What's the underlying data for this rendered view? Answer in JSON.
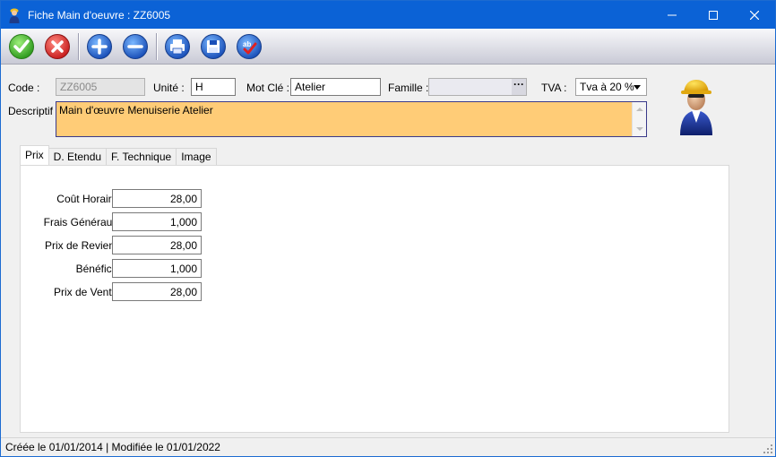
{
  "window": {
    "title": "Fiche Main d'oeuvre : ZZ6005",
    "icons": {
      "app": "worker-icon",
      "minimize": "minimize-icon",
      "maximize": "maximize-icon",
      "close": "close-icon"
    }
  },
  "toolbar": {
    "buttons": [
      {
        "name": "validate-button",
        "icon": "green-check-icon"
      },
      {
        "name": "cancel-button",
        "icon": "red-x-icon"
      },
      {
        "name": "add-button",
        "icon": "plus-icon"
      },
      {
        "name": "remove-button",
        "icon": "minus-icon"
      },
      {
        "name": "print-button",
        "icon": "printer-icon"
      },
      {
        "name": "save-button",
        "icon": "floppy-disk-icon"
      },
      {
        "name": "spellcheck-button",
        "icon": "spellcheck-icon"
      }
    ]
  },
  "header": {
    "code_label": "Code :",
    "code_value": "ZZ6005",
    "unite_label": "Unité :",
    "unite_value": "H",
    "motcle_label": "Mot Clé :",
    "motcle_value": "Atelier",
    "famille_label": "Famille :",
    "famille_value": "",
    "famille_button": "···",
    "tva_label": "TVA :",
    "tva_value": "Tva à 20 %",
    "descript_label": "Descriptif :",
    "descript_value": "Main d'œuvre Menuiserie Atelier"
  },
  "tabs": [
    {
      "label": "Prix",
      "active": true
    },
    {
      "label": "D. Etendu",
      "active": false
    },
    {
      "label": "F. Technique",
      "active": false
    },
    {
      "label": "Image",
      "active": false
    }
  ],
  "prix": {
    "rows": [
      {
        "label": "Coût Horaire :",
        "value": "28,00"
      },
      {
        "label": "Frais Généraux :",
        "value": "1,000"
      },
      {
        "label": "Prix de Revient :",
        "value": "28,00"
      },
      {
        "label": "Bénéfice :",
        "value": "1,000"
      },
      {
        "label": "Prix de Vente :",
        "value": "28,00"
      }
    ]
  },
  "status": {
    "text": "Créée le 01/01/2014 | Modifiée le 01/01/2022"
  },
  "colors": {
    "titlebar": "#0b62d6",
    "descript_bg": "#ffcc77"
  }
}
